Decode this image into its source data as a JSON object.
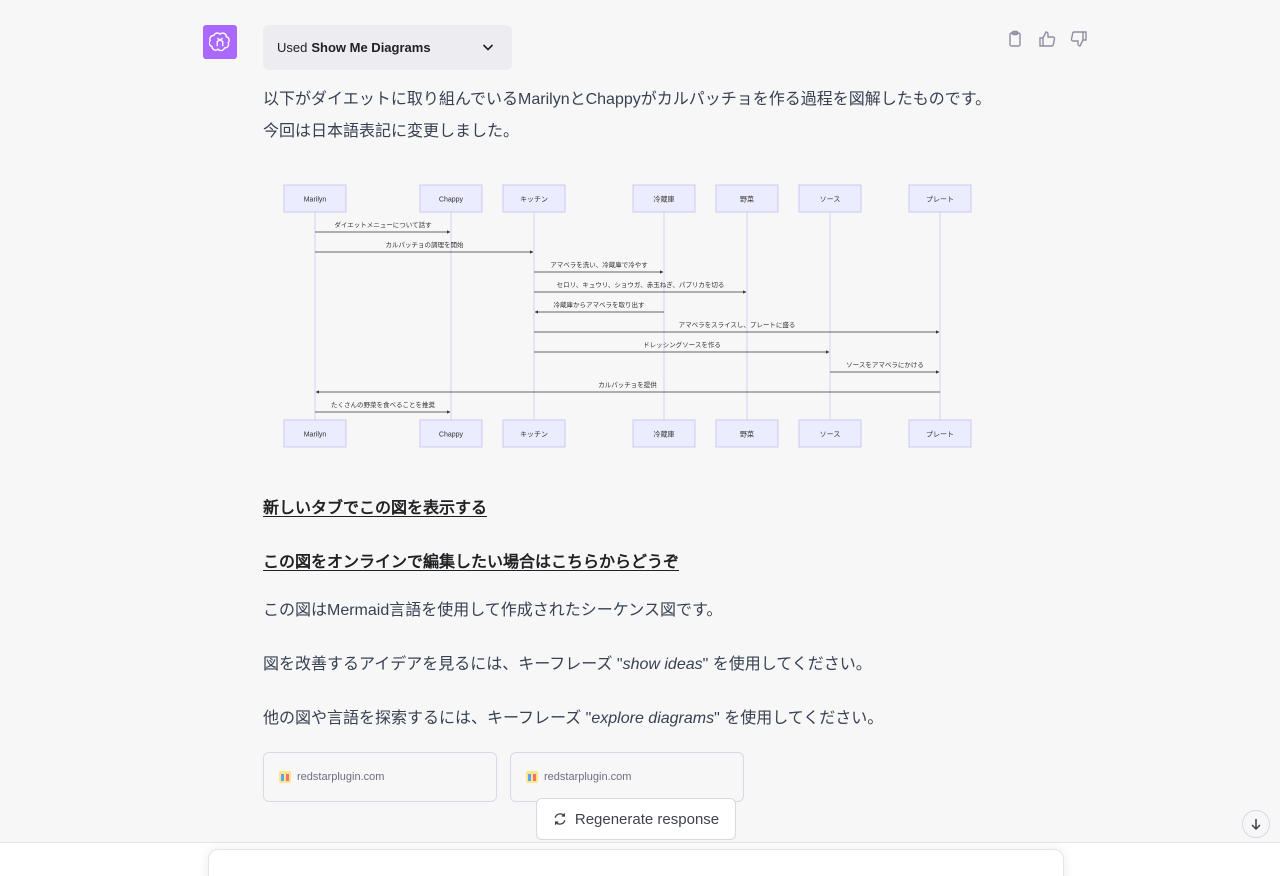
{
  "message": {
    "plugin_prefix": "Used",
    "plugin_name": "Show Me Diagrams",
    "intro": "以下がダイエットに取り組んでいるMarilynとChappyがカルパッチョを作る過程を図解したものです。今回は日本語表記に変更しました。",
    "link_new_tab": "新しいタブでこの図を表示する",
    "link_edit_online": "この図をオンラインで編集したい場合はこちらからどうぞ",
    "info_mermaid": "この図はMermaid言語を使用して作成されたシーケンス図です。",
    "show_ideas_pre": "図を改善するアイデアを見るには、キーフレーズ \"",
    "show_ideas_key": "show ideas",
    "show_ideas_post": "\" を使用してください。",
    "explore_pre": "他の図や言語を探索するには、キーフレーズ \"",
    "explore_key": "explore diagrams",
    "explore_post": "\" を使用してください。",
    "sources": [
      "redstarplugin.com",
      "redstarplugin.com"
    ],
    "regenerate_label": "Regenerate response"
  },
  "diagram": {
    "participants": [
      "Marilyn",
      "Chappy",
      "キッチン",
      "冷蔵庫",
      "野菜",
      "ソース",
      "プレート"
    ],
    "messages": [
      {
        "from": 0,
        "to": 1,
        "text": "ダイエットメニューについて話す"
      },
      {
        "from": 0,
        "to": 2,
        "text": "カルパッチョの調理を開始"
      },
      {
        "from": 2,
        "to": 3,
        "text": "アマベラを洗い、冷蔵庫で冷やす"
      },
      {
        "from": 2,
        "to": 4,
        "text": "セロリ、キュウリ、ショウガ、赤玉ねぎ、パプリカを切る"
      },
      {
        "from": 3,
        "to": 2,
        "text": "冷蔵庫からアマベラを取り出す"
      },
      {
        "from": 2,
        "to": 6,
        "text": "アマベラをスライスし、プレートに盛る"
      },
      {
        "from": 2,
        "to": 5,
        "text": "ドレッシングソースを作る"
      },
      {
        "from": 5,
        "to": 6,
        "text": "ソースをアマベラにかける"
      },
      {
        "from": 6,
        "to": 0,
        "text": "カルパッチョを提供"
      },
      {
        "from": 0,
        "to": 1,
        "text": "たくさんの野菜を食べることを推奨"
      }
    ]
  },
  "colors": {
    "avatar": "#ab68ff",
    "actor_fill": "#ececff",
    "actor_stroke": "#cbc8f0"
  }
}
